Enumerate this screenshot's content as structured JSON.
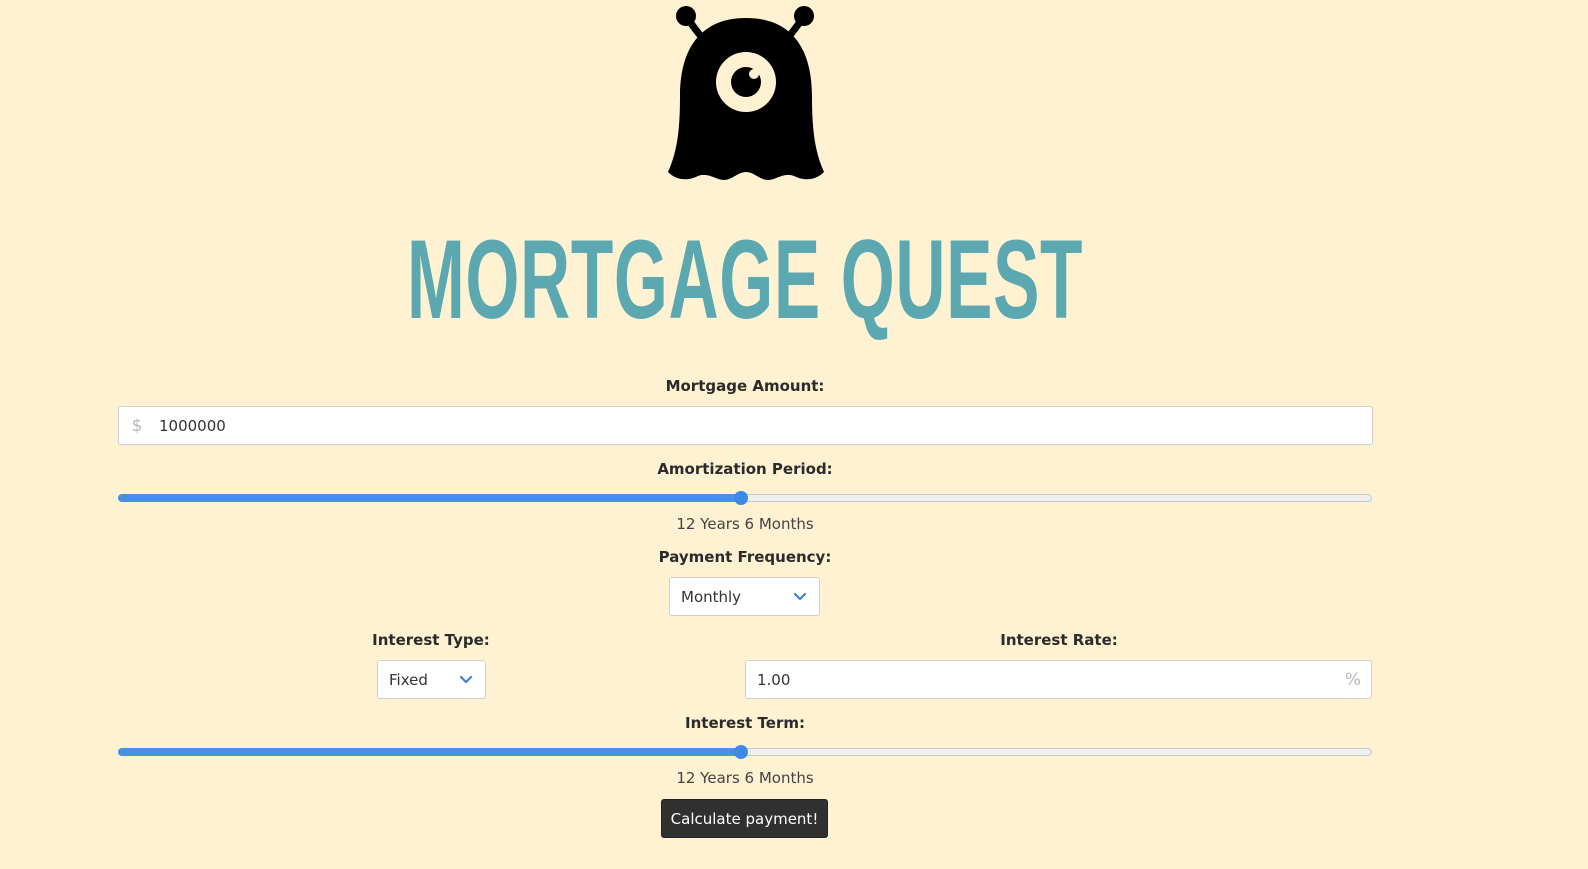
{
  "app": {
    "title": "MORTGAGE QUEST",
    "logo_icon": "one-eyed-monster-icon",
    "background_color": "#fff2d2",
    "title_color": "#5ba8b1",
    "accent_color": "#4a90e2"
  },
  "mortgage_amount": {
    "label": "Mortgage Amount:",
    "prefix": "$",
    "value": "1000000"
  },
  "amortization_period": {
    "label": "Amortization Period:",
    "value_text": "12 Years 6 Months",
    "slider_fraction": 0.497
  },
  "payment_frequency": {
    "label": "Payment Frequency:",
    "selected": "Monthly"
  },
  "interest_type": {
    "label": "Interest Type:",
    "selected": "Fixed"
  },
  "interest_rate": {
    "label": "Interest Rate:",
    "value": "1.00",
    "suffix": "%"
  },
  "interest_term": {
    "label": "Interest Term:",
    "value_text": "12 Years 6 Months",
    "slider_fraction": 0.497
  },
  "actions": {
    "calculate_label": "Calculate payment!"
  }
}
